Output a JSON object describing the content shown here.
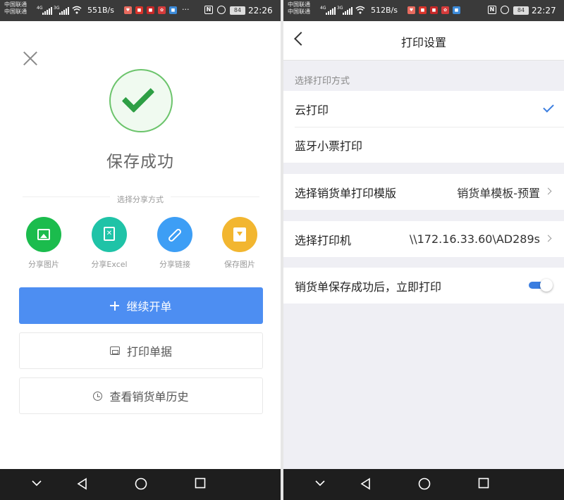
{
  "left": {
    "status": {
      "carrier1": "中国联通",
      "carrier2": "中国联通",
      "net1": "4G",
      "net2": "3G",
      "speed": "551B/s",
      "battery": "84",
      "time": "22:26"
    },
    "success_title": "保存成功",
    "share_label": "选择分享方式",
    "share": [
      {
        "label": "分享图片",
        "color": "#1bbc4d"
      },
      {
        "label": "分享Excel",
        "color": "#1fc3a7"
      },
      {
        "label": "分享链接",
        "color": "#3d9ef5"
      },
      {
        "label": "保存图片",
        "color": "#f2b630"
      }
    ],
    "buttons": {
      "continue": "继续开单",
      "print": "打印单据",
      "history": "查看销货单历史"
    }
  },
  "right": {
    "status": {
      "carrier1": "中国联通",
      "carrier2": "中国联通",
      "net1": "4G",
      "net2": "3G",
      "speed": "512B/s",
      "battery": "84",
      "time": "22:27"
    },
    "title": "打印设置",
    "section_label": "选择打印方式",
    "methods": [
      "云打印",
      "蓝牙小票打印"
    ],
    "template": {
      "label": "选择销货单打印模版",
      "value": "销货单模板-预置"
    },
    "printer": {
      "label": "选择打印机",
      "value": "\\\\172.16.33.60\\AD289s"
    },
    "auto_print": {
      "label": "销货单保存成功后，立即打印",
      "on": true
    }
  },
  "colors": {
    "primary": "#4d8ef2",
    "success": "#2e9f45",
    "accent": "#3a7de0"
  }
}
